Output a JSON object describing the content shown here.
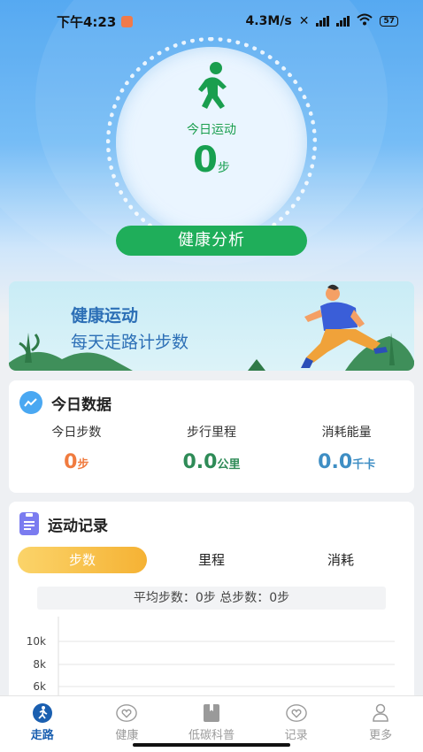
{
  "status_bar": {
    "time": "下午4:23",
    "network_speed": "4.3M/s",
    "battery": "57"
  },
  "dial": {
    "icon": "walking-person-icon",
    "label": "今日运动",
    "steps": "0",
    "unit": "步"
  },
  "analysis_button": "健康分析",
  "banner": {
    "title": "健康运动",
    "subtitle": "每天走路计步数"
  },
  "today": {
    "title": "今日数据",
    "metrics": [
      {
        "label": "今日步数",
        "value": "0",
        "unit": "步",
        "color": "#f07b3f"
      },
      {
        "label": "步行里程",
        "value": "0.0",
        "unit": "公里",
        "color": "#2e8b57"
      },
      {
        "label": "消耗能量",
        "value": "0.0",
        "unit": "千卡",
        "color": "#3e8ec4"
      }
    ]
  },
  "records": {
    "title": "运动记录",
    "tabs": [
      "步数",
      "里程",
      "消耗"
    ],
    "active_tab": "步数",
    "summary": "平均步数：0步 总步数：0步",
    "y_ticks": [
      "10k",
      "8k",
      "6k"
    ]
  },
  "nav": {
    "items": [
      {
        "label": "走路",
        "icon": "running-icon",
        "active": true
      },
      {
        "label": "健康",
        "icon": "heart-icon",
        "active": false
      },
      {
        "label": "低碳科普",
        "icon": "book-icon",
        "active": false
      },
      {
        "label": "记录",
        "icon": "heart-outline-icon",
        "active": false
      },
      {
        "label": "更多",
        "icon": "person-icon",
        "active": false
      }
    ]
  },
  "colors": {
    "primary_green": "#1fae5a",
    "hero_blue": "#4aa3f0",
    "nav_active": "#1a5fb0"
  }
}
